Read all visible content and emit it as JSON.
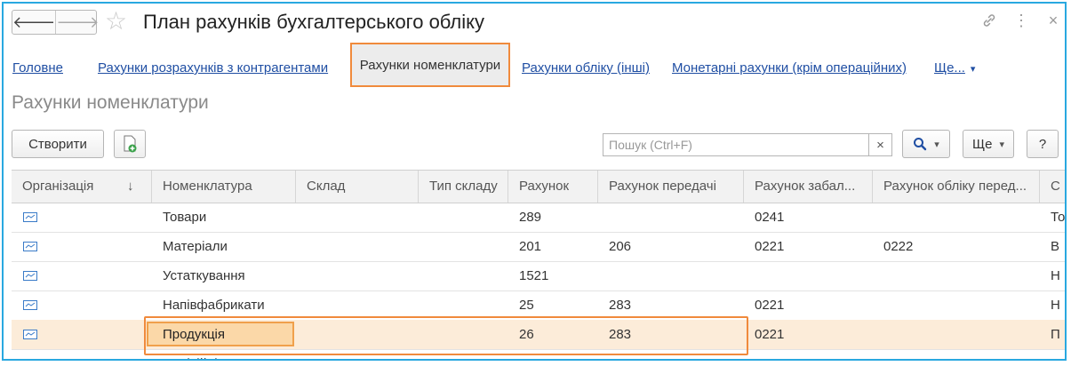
{
  "window": {
    "title": "План рахунків бухгалтерського обліку",
    "back_glyph": "🡐",
    "forward_glyph": "🡒",
    "star_glyph": "☆",
    "link_glyph": "🔗",
    "menu_glyph": "⋮",
    "close_glyph": "×"
  },
  "tabs": [
    {
      "label": "Головне"
    },
    {
      "label": "Рахунки розрахунків з контрагентами"
    },
    {
      "label": "Рахунки номенклатури",
      "active": true
    },
    {
      "label": "Рахунки обліку (інші)"
    },
    {
      "label": "Монетарні рахунки (крім операційних)"
    },
    {
      "label": "Ще..."
    }
  ],
  "section_title": "Рахунки номенклатури",
  "toolbar": {
    "create_label": "Створити",
    "search_placeholder": "Пошук (Ctrl+F)",
    "clear_glyph": "×",
    "more_label": "Ще",
    "help_label": "?",
    "dropdown_glyph": "▾"
  },
  "table": {
    "sort_glyph": "↓",
    "columns": [
      "Організація",
      "Номенклатура",
      "Склад",
      "Тип складу",
      "Рахунок",
      "Рахунок передачі",
      "Рахунок забал...",
      "Рахунок обліку перед...",
      "С"
    ],
    "rows": [
      {
        "nomenclature": "Товари",
        "account": "289",
        "transfer": "",
        "offbalance": "0241",
        "accounting_transfer": "",
        "last": "То"
      },
      {
        "nomenclature": "Матеріали",
        "account": "201",
        "transfer": "206",
        "offbalance": "0221",
        "accounting_transfer": "0222",
        "last": "В"
      },
      {
        "nomenclature": "Устаткування",
        "account": "1521",
        "transfer": "",
        "offbalance": "",
        "accounting_transfer": "",
        "last": "Н"
      },
      {
        "nomenclature": "Напівфабрикати",
        "account": "25",
        "transfer": "283",
        "offbalance": "0221",
        "accounting_transfer": "",
        "last": "Н"
      },
      {
        "nomenclature": "Продукція",
        "account": "26",
        "transfer": "283",
        "offbalance": "0221",
        "accounting_transfer": "",
        "last": "П",
        "selected": true
      },
      {
        "nomenclature": "Комісійні витрати",
        "account": "",
        "transfer": "",
        "offbalance": "",
        "accounting_transfer": "",
        "last": "П"
      }
    ]
  },
  "colors": {
    "accent": "#29a8e0",
    "highlight": "#f08a3c",
    "link": "#1f4ea3"
  }
}
